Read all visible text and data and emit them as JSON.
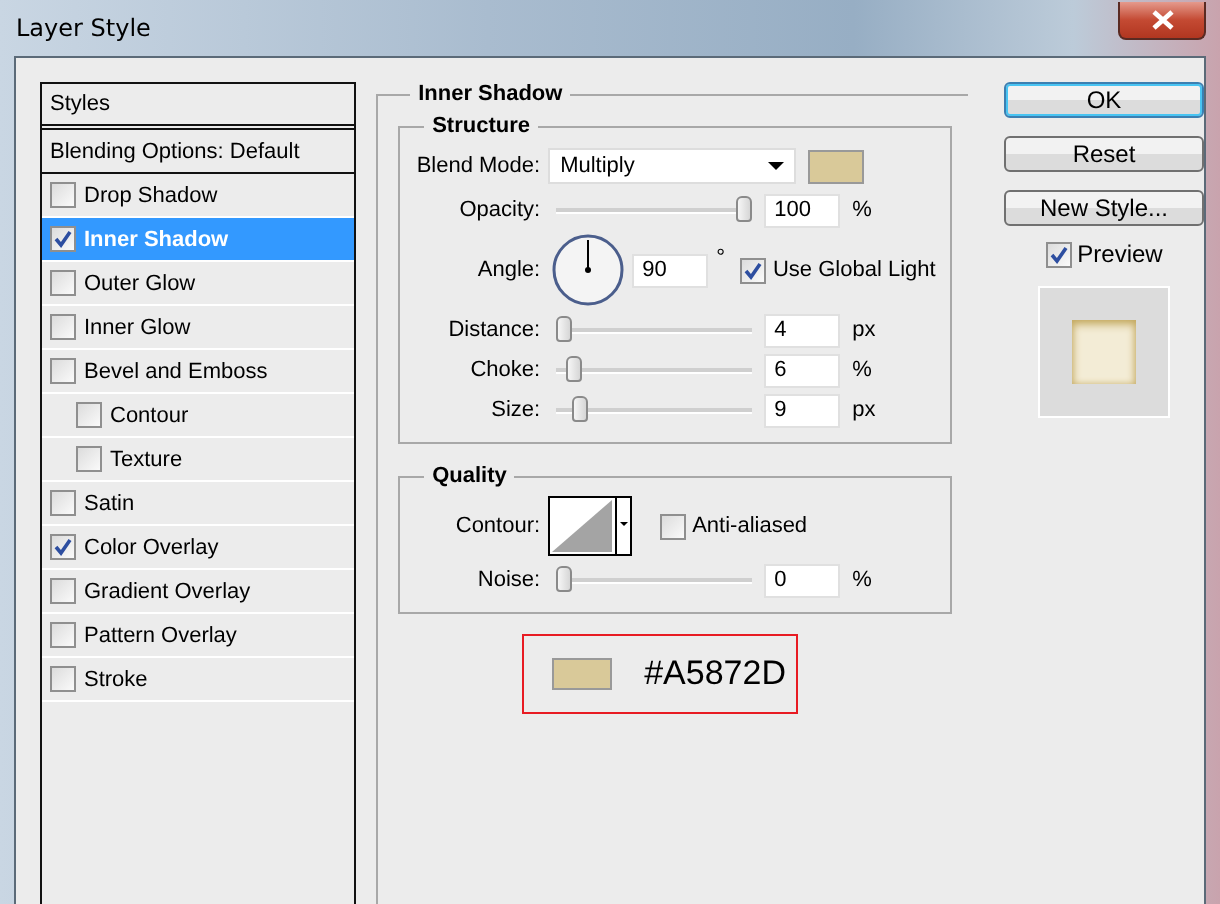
{
  "window": {
    "title": "Layer Style"
  },
  "styles_list": {
    "header": "Styles",
    "blending": "Blending Options: Default",
    "items": [
      {
        "label": "Drop Shadow",
        "checked": false,
        "selected": false
      },
      {
        "label": "Inner Shadow",
        "checked": true,
        "selected": true
      },
      {
        "label": "Outer Glow",
        "checked": false,
        "selected": false
      },
      {
        "label": "Inner Glow",
        "checked": false,
        "selected": false
      },
      {
        "label": "Bevel and Emboss",
        "checked": false,
        "selected": false,
        "children": [
          {
            "label": "Contour",
            "checked": false,
            "selected": false
          },
          {
            "label": "Texture",
            "checked": false,
            "selected": false
          }
        ]
      },
      {
        "label": "Satin",
        "checked": false,
        "selected": false
      },
      {
        "label": "Color Overlay",
        "checked": true,
        "selected": false
      },
      {
        "label": "Gradient Overlay",
        "checked": false,
        "selected": false
      },
      {
        "label": "Pattern Overlay",
        "checked": false,
        "selected": false
      },
      {
        "label": "Stroke",
        "checked": false,
        "selected": false
      }
    ]
  },
  "panel": {
    "title": "Inner Shadow",
    "structure": {
      "title": "Structure",
      "blend_mode": {
        "label": "Blend Mode:",
        "value": "Multiply",
        "color": "#d9c999"
      },
      "rows": [
        {
          "kind": "slider",
          "label": "Opacity:",
          "level": 1,
          "value": "100",
          "unit": "%"
        },
        {
          "kind": "angle",
          "label": "Angle:",
          "value": "90",
          "unit": "°",
          "global_light": {
            "label": "Use Global Light",
            "checked": true
          }
        },
        {
          "kind": "slider",
          "label": "Distance:",
          "level": 0,
          "value": "4",
          "unit": "px"
        },
        {
          "kind": "slider",
          "label": "Choke:",
          "level": 0.06,
          "value": "6",
          "unit": "%"
        },
        {
          "kind": "slider",
          "label": "Size:",
          "level": 0.09,
          "value": "9",
          "unit": "px"
        }
      ]
    },
    "quality": {
      "title": "Quality",
      "contour": {
        "label": "Contour:"
      },
      "anti_aliased": {
        "label": "Anti-aliased",
        "checked": false
      },
      "noise": {
        "kind": "slider",
        "label": "Noise:",
        "level": 0,
        "value": "0",
        "unit": "%"
      }
    },
    "annotation": {
      "color": "#d9c999",
      "text": "#A5872D"
    }
  },
  "buttons": [
    {
      "label": "OK",
      "default": true
    },
    {
      "label": "Reset",
      "default": false
    },
    {
      "label": "New Style...",
      "default": false
    }
  ],
  "preview": {
    "label": "Preview",
    "checked": true
  }
}
